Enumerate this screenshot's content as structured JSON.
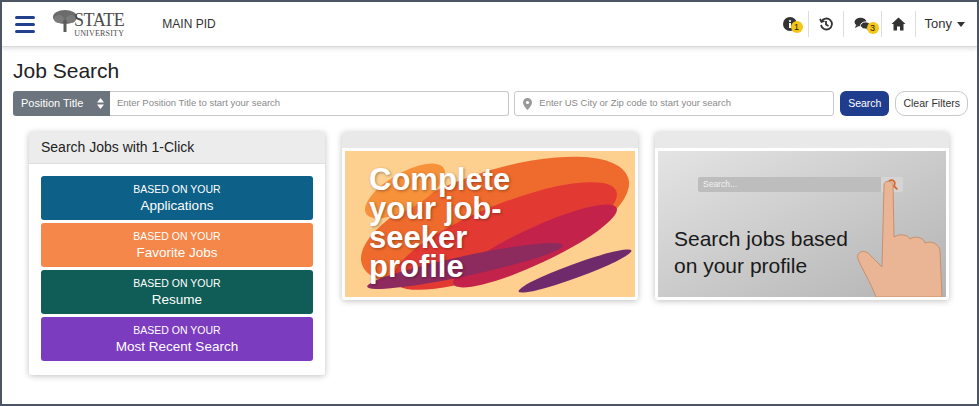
{
  "header": {
    "logo_line1": "STATE",
    "logo_line2": "UNIVERSITY",
    "app_label": "MAIN PID",
    "info_badge": "1",
    "messages_badge": "3",
    "user": "Tony"
  },
  "page_title": "Job Search",
  "search": {
    "field_select": "Position Title",
    "title_placeholder": "Enter Position Title to start your search",
    "location_placeholder": "Enter US City or Zip code to start your search",
    "search_button": "Search",
    "clear_button": "Clear Filters"
  },
  "one_click": {
    "title": "Search Jobs with 1-Click",
    "items": [
      {
        "prefix": "BASED ON YOUR",
        "label": "Applications",
        "color": "#0d6087"
      },
      {
        "prefix": "BASED ON YOUR",
        "label": "Favorite Jobs",
        "color": "#f5874a"
      },
      {
        "prefix": "BASED ON YOUR",
        "label": "Resume",
        "color": "#0f5d56"
      },
      {
        "prefix": "BASED ON YOUR",
        "label": "Most Recent Search",
        "color": "#7c3cbf"
      }
    ]
  },
  "profile_banner": {
    "text": "Complete your job-seeker profile"
  },
  "search_banner": {
    "text": "Search jobs based on your profile",
    "search_placeholder": "Search..."
  }
}
